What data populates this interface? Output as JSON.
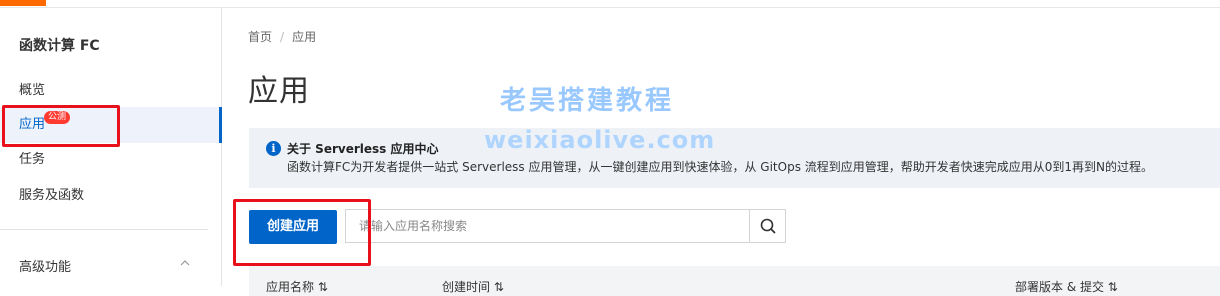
{
  "sidebar": {
    "title": "函数计算 FC",
    "items": [
      {
        "label": "概览"
      },
      {
        "label": "应用",
        "badge": "公测"
      },
      {
        "label": "任务"
      },
      {
        "label": "服务及函数"
      }
    ],
    "section": {
      "label": "高级功能"
    }
  },
  "breadcrumb": {
    "home": "首页",
    "sep": "/",
    "current": "应用"
  },
  "page": {
    "title": "应用"
  },
  "watermark": {
    "line1": "老吴搭建教程",
    "line2": "weixiaolive.com"
  },
  "info": {
    "title": "关于 Serverless 应用中心",
    "description": "函数计算FC为开发者提供一站式 Serverless 应用管理，从一键创建应用到快速体验，从 GitOps 流程到应用管理，帮助开发者快速完成应用从0到1再到N的过程。"
  },
  "toolbar": {
    "create_label": "创建应用",
    "search": {
      "placeholder": "请输入应用名称搜索",
      "value": ""
    }
  },
  "table": {
    "headers": [
      "应用名称 ⇅",
      "创建时间 ⇅",
      "部署版本 & 提交 ⇅"
    ]
  },
  "colors": {
    "accent": "#0064c8",
    "brand": "#ff6a00",
    "highlight": "#e8101b"
  }
}
